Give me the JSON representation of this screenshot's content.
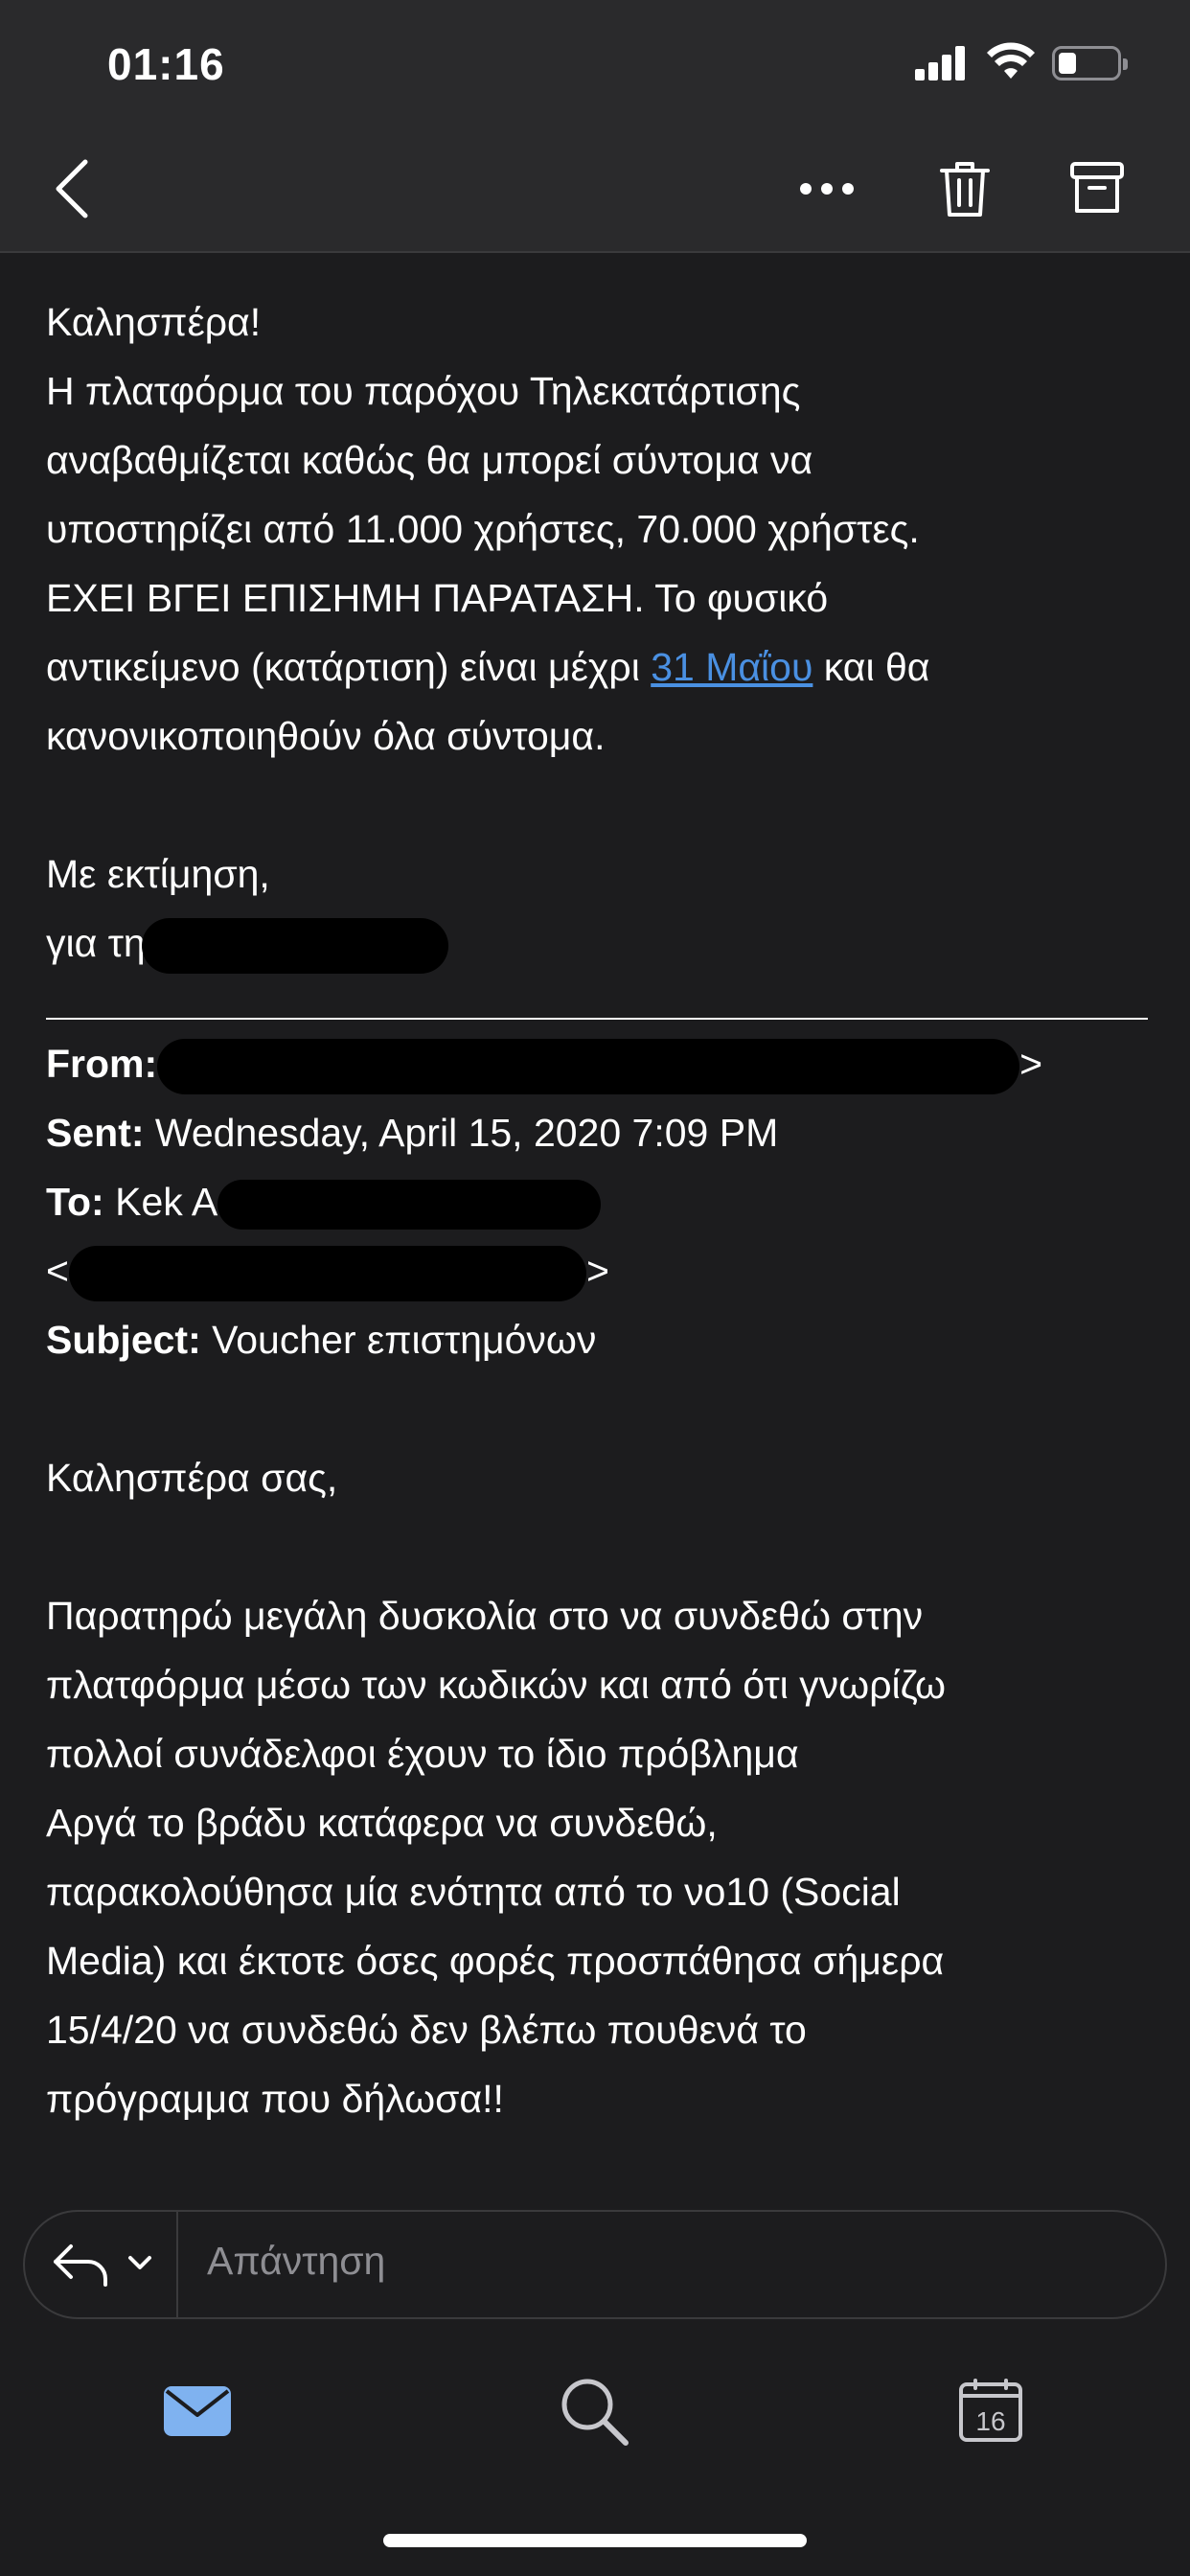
{
  "status_bar": {
    "time": "01:16"
  },
  "toolbar": {
    "back_icon": "chevron-left-icon",
    "more_icon": "more-horizontal-icon",
    "delete_icon": "trash-icon",
    "archive_icon": "archive-icon"
  },
  "email": {
    "greeting": "Καλησπέρα!",
    "body_line1": "Η πλατφόρμα του παρόχου Τηλεκατάρτισης",
    "body_line2": "αναβαθμίζεται καθώς θα μπορεί σύντομα να",
    "body_line3": "υποστηρίζει από 11.000 χρήστες, 70.000 χρήστες.",
    "body_line4": "ΕΧΕΙ ΒΓΕΙ ΕΠΙΣΗΜΗ ΠΑΡΑΤΑΣΗ. Το φυσικό",
    "body_line5_pre": "αντικείμενο (κατάρτιση) είναι μέχρι ",
    "body_line5_link": "31 Μαΐου",
    "body_line5_post": " και θα",
    "body_line6": "κανονικοποιηθούν όλα σύντομα.",
    "closing": "Με εκτίμηση,",
    "signature_pre": "για τη"
  },
  "quoted_header": {
    "from_label": "From:",
    "from_tail": ">",
    "sent_label": "Sent:",
    "sent_value": "Wednesday, April 15, 2020 7:09 PM",
    "to_label": "To:",
    "to_value_pre": "Kek A",
    "to_email_open": "<",
    "to_email_close": ">",
    "subject_label": "Subject:",
    "subject_value": "Voucher επιστημόνων"
  },
  "quoted_body": {
    "greeting": "Καλησπέρα σας,",
    "line1": "Παρατηρώ μεγάλη δυσκολία στο να συνδεθώ στην",
    "line2": "πλατφόρμα μέσω των κωδικών και από ότι γνωρίζω",
    "line3": "πολλοί συνάδελφοι έχουν το ίδιο πρόβλημα",
    "line4": "Αργά το βράδυ κατάφερα να συνδεθώ,",
    "line5": "παρακολούθησα μία ενότητα από το νο10 (Social",
    "line6": "Media) και έκτοτε όσες φορές προσπάθησα σήμερα",
    "line7": "15/4/20 να συνδεθώ δεν βλέπω πουθενά το",
    "line8": "πρόγραμμα που δήλωσα!!"
  },
  "reply_bar": {
    "placeholder": "Απάντηση"
  },
  "tab_bar": {
    "mail_icon": "mail-icon",
    "search_icon": "search-icon",
    "calendar_icon": "calendar-icon",
    "calendar_day": "16"
  },
  "colors": {
    "background": "#1c1c1e",
    "bar_background": "#2a2a2c",
    "link": "#4a90e2",
    "accent_blue": "#7fb2f0",
    "placeholder": "#8e8e93"
  }
}
